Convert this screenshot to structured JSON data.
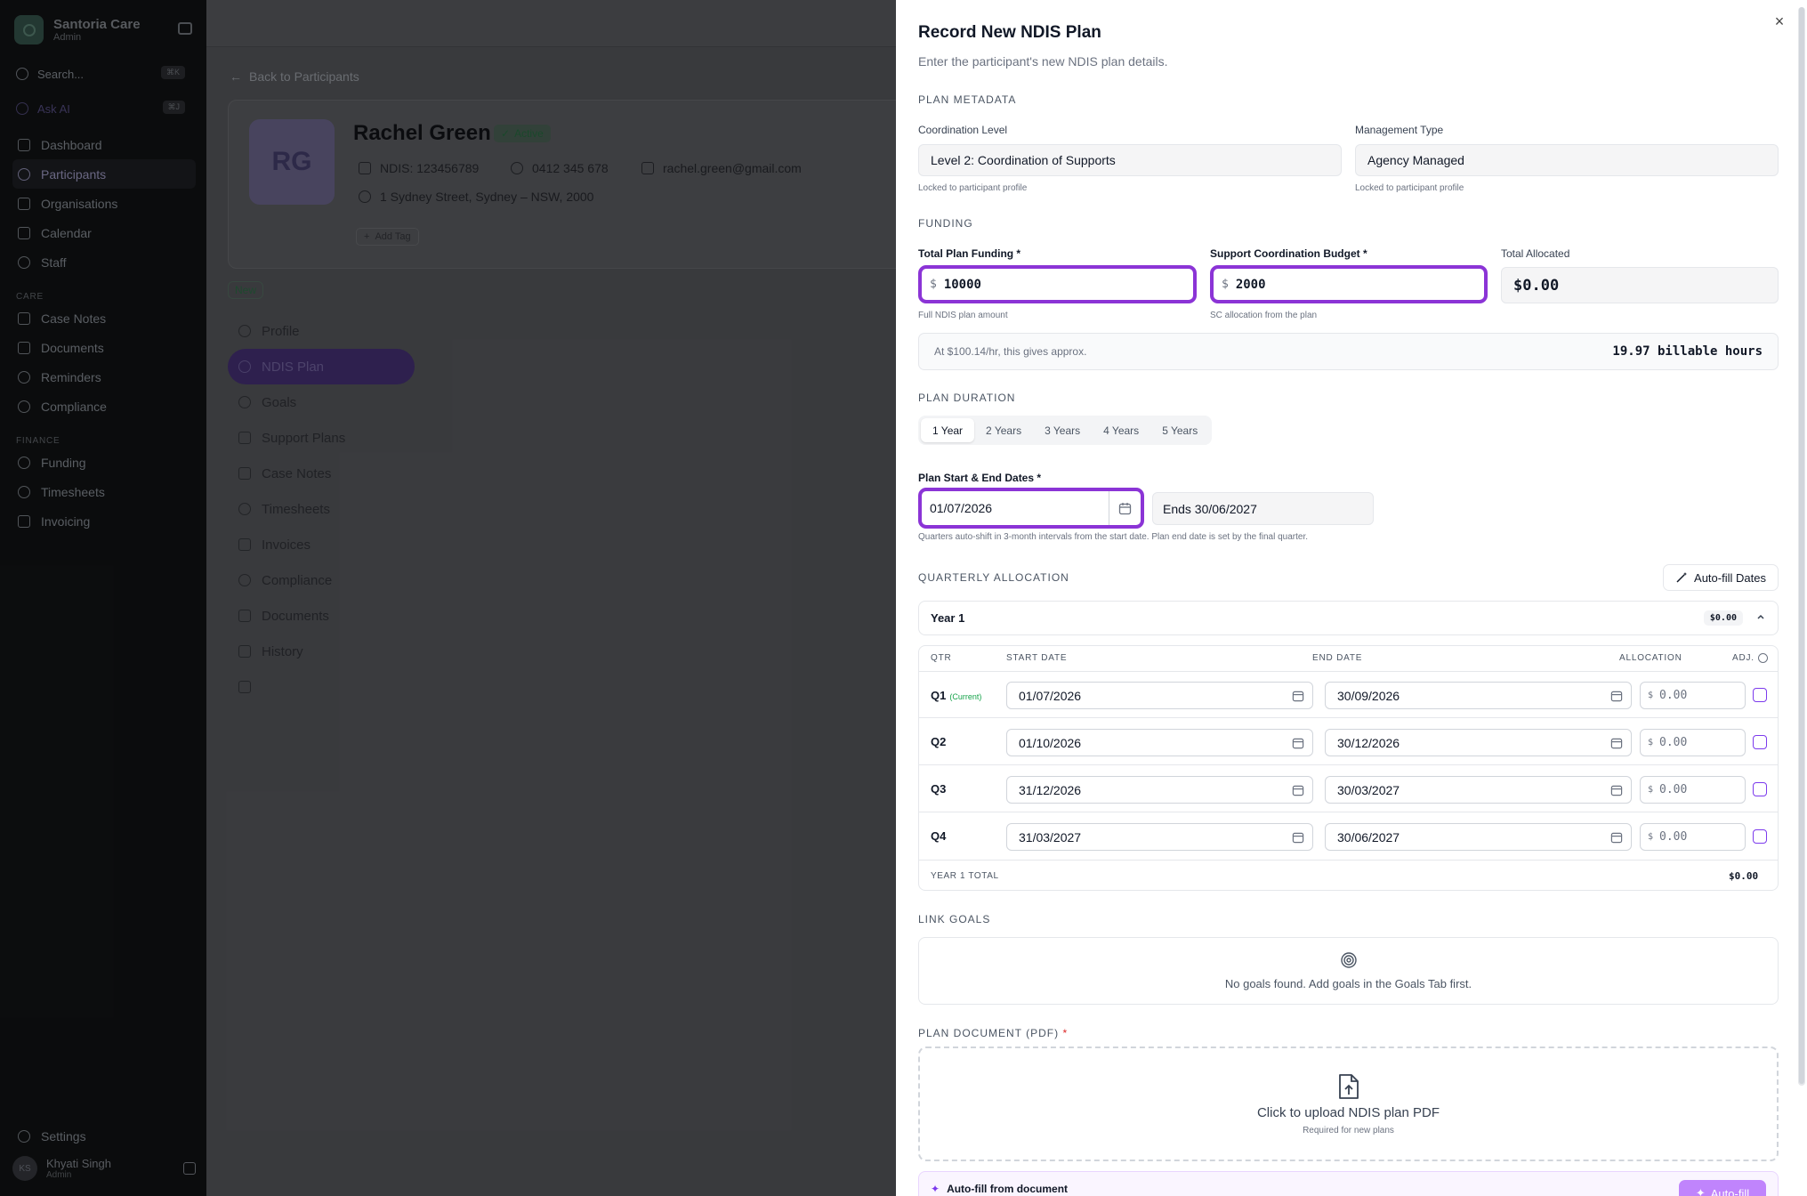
{
  "sidebar": {
    "brand": {
      "name": "Santoria Care",
      "role": "Admin"
    },
    "search": {
      "label": "Search...",
      "shortcut": "⌘K"
    },
    "ask_ai": {
      "label": "Ask AI",
      "shortcut": "⌘J"
    },
    "main_items": [
      {
        "label": "Dashboard"
      },
      {
        "label": "Participants"
      },
      {
        "label": "Organisations"
      },
      {
        "label": "Calendar"
      },
      {
        "label": "Staff"
      }
    ],
    "care_section": "CARE",
    "care_items": [
      {
        "label": "Case Notes"
      },
      {
        "label": "Documents"
      },
      {
        "label": "Reminders"
      },
      {
        "label": "Compliance"
      }
    ],
    "finance_section": "FINANCE",
    "finance_items": [
      {
        "label": "Funding"
      },
      {
        "label": "Timesheets"
      },
      {
        "label": "Invoicing"
      }
    ],
    "settings": "Settings",
    "user": {
      "initials": "KS",
      "name": "Khyati Singh",
      "role": "Admin"
    }
  },
  "participant": {
    "back_label": "Back to Participants",
    "initials": "RG",
    "name": "Rachel Green",
    "status": "Active",
    "ndis": "NDIS: 123456789",
    "phone": "0412 345 678",
    "email": "rachel.green@gmail.com",
    "address": "1 Sydney Street, Sydney – NSW, 2000",
    "add_tag": "Add Tag",
    "badge": "New",
    "nav": [
      {
        "label": "Profile"
      },
      {
        "label": "NDIS Plan"
      },
      {
        "label": "Goals"
      },
      {
        "label": "Support Plans"
      },
      {
        "label": "Case Notes"
      },
      {
        "label": "Timesheets"
      },
      {
        "label": "Invoices"
      },
      {
        "label": "Compliance"
      },
      {
        "label": "Documents"
      },
      {
        "label": "History"
      }
    ]
  },
  "modal": {
    "title": "Record New NDIS Plan",
    "subtitle": "Enter the participant's new NDIS plan details.",
    "close": "×",
    "metadata": {
      "section": "PLAN METADATA",
      "coordination_label": "Coordination Level",
      "coordination_value": "Level 2: Coordination of Supports",
      "coordination_hint": "Locked to participant profile",
      "management_label": "Management Type",
      "management_value": "Agency Managed",
      "management_hint": "Locked to participant profile"
    },
    "funding": {
      "section": "FUNDING",
      "total_label": "Total Plan Funding *",
      "currency": "$",
      "total_value": "10000",
      "total_hint": "Full NDIS plan amount",
      "sc_label": "Support Coordination Budget *",
      "sc_value": "2000",
      "sc_hint": "SC allocation from the plan",
      "allocated_label": "Total Allocated",
      "allocated_value": "$0.00",
      "approx_text": "At $100.14/hr, this gives approx.",
      "hours": "19.97 billable hours"
    },
    "duration": {
      "section": "PLAN DURATION",
      "options": [
        "1 Year",
        "2 Years",
        "3 Years",
        "4 Years",
        "5 Years"
      ],
      "selected": "1 Year",
      "dates_label": "Plan Start & End Dates *",
      "start": "01/07/2026",
      "end": "Ends 30/06/2027",
      "hint": "Quarters auto-shift in 3-month intervals from the start date. Plan end date is set by the final quarter."
    },
    "quarterly": {
      "section": "QUARTERLY ALLOCATION",
      "autofill": "Auto-fill Dates",
      "year_label": "Year 1",
      "year_amount": "$0.00",
      "headers": {
        "qtr": "QTR",
        "start": "START DATE",
        "end": "END DATE",
        "alloc": "ALLOCATION",
        "adj": "ADJ."
      },
      "currency": "$",
      "rows": [
        {
          "q": "Q1",
          "tag": "(Current)",
          "start": "01/07/2026",
          "end": "30/09/2026",
          "alloc": "0.00"
        },
        {
          "q": "Q2",
          "tag": "",
          "start": "01/10/2026",
          "end": "30/12/2026",
          "alloc": "0.00"
        },
        {
          "q": "Q3",
          "tag": "",
          "start": "31/12/2026",
          "end": "30/03/2027",
          "alloc": "0.00"
        },
        {
          "q": "Q4",
          "tag": "",
          "start": "31/03/2027",
          "end": "30/06/2027",
          "alloc": "0.00"
        }
      ],
      "total_label": "YEAR 1 TOTAL",
      "total_value": "$0.00"
    },
    "goals": {
      "section": "LINK GOALS",
      "empty": "No goals found. Add goals in the Goals Tab first."
    },
    "document": {
      "section": "PLAN DOCUMENT (PDF)",
      "required": "*",
      "upload": "Click to upload NDIS plan PDF",
      "upload_hint": "Required for new plans",
      "autofill_label": "Auto-fill from document",
      "autofill_button": "Auto-fill"
    }
  },
  "colors": {
    "accent": "#8b34d6",
    "sidebar_bg": "#0c0d0e",
    "backdrop": "#3b3c3f",
    "success": "#16a34a"
  }
}
